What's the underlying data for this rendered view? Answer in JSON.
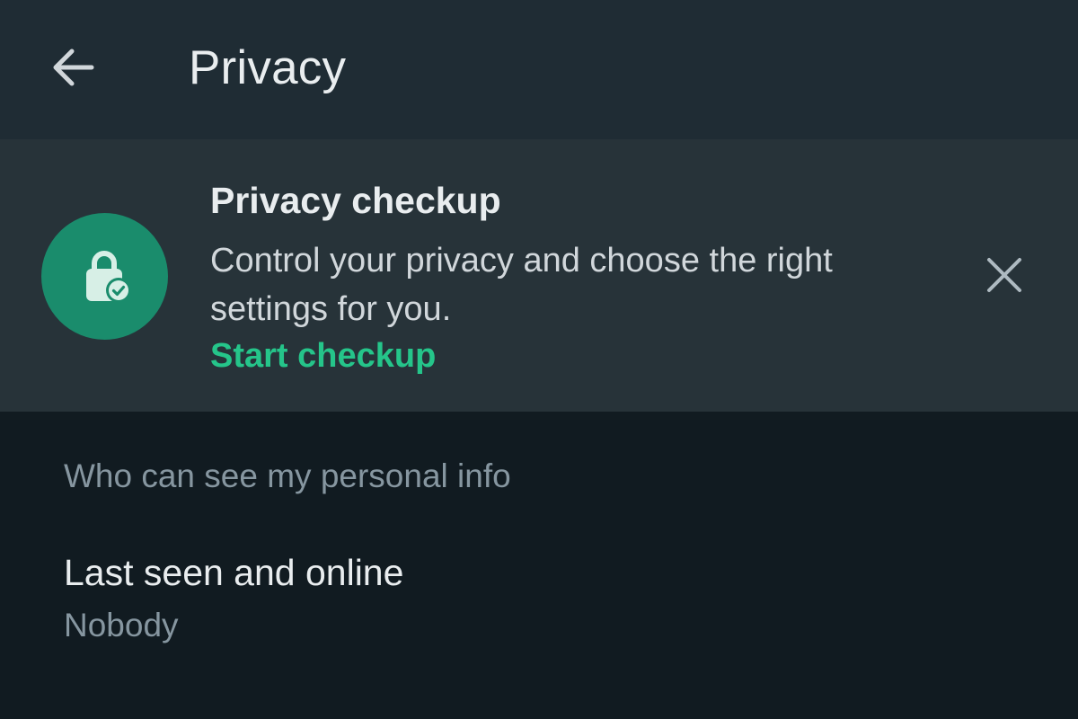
{
  "colors": {
    "background": "#111b21",
    "app_bar": "#1f2c34",
    "banner": "#273339",
    "accent": "#25c58a",
    "icon_circle": "#1a8c6c",
    "primary_text": "#e9edef",
    "secondary_text": "#8696a0"
  },
  "header": {
    "back_icon": "arrow-left",
    "title": "Privacy"
  },
  "banner": {
    "icon": "lock-check",
    "title": "Privacy checkup",
    "description": "Control your privacy and choose the right settings for you.",
    "link_label": "Start checkup",
    "dismiss_icon": "close"
  },
  "section": {
    "header": "Who can see my personal info",
    "items": [
      {
        "title": "Last seen and online",
        "value": "Nobody"
      }
    ]
  }
}
